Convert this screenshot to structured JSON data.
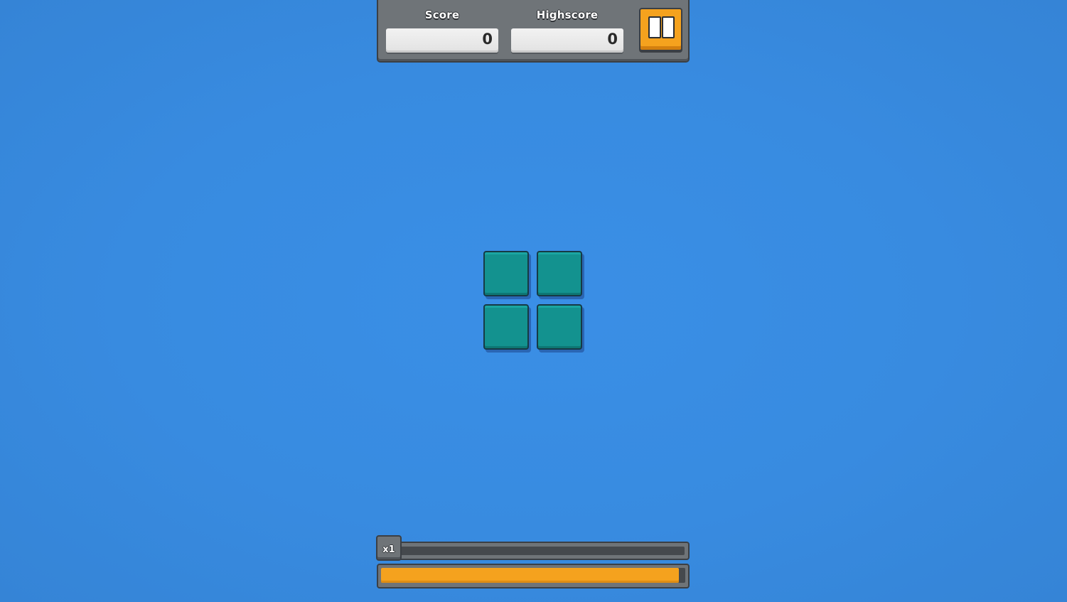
{
  "hud": {
    "score_label": "Score",
    "score_value": "0",
    "highscore_label": "Highscore",
    "highscore_value": "0",
    "pause_icon": "pause-icon"
  },
  "piece": {
    "color": "#13928f",
    "shape": "2x2-square",
    "blocks": 4
  },
  "multiplier": {
    "label": "x1",
    "progress": 0
  },
  "timer": {
    "fill_percent": 98,
    "color": "#f5a21e"
  },
  "colors": {
    "background": "#388be0",
    "panel": "#6f7478",
    "accent": "#f5a21e"
  }
}
